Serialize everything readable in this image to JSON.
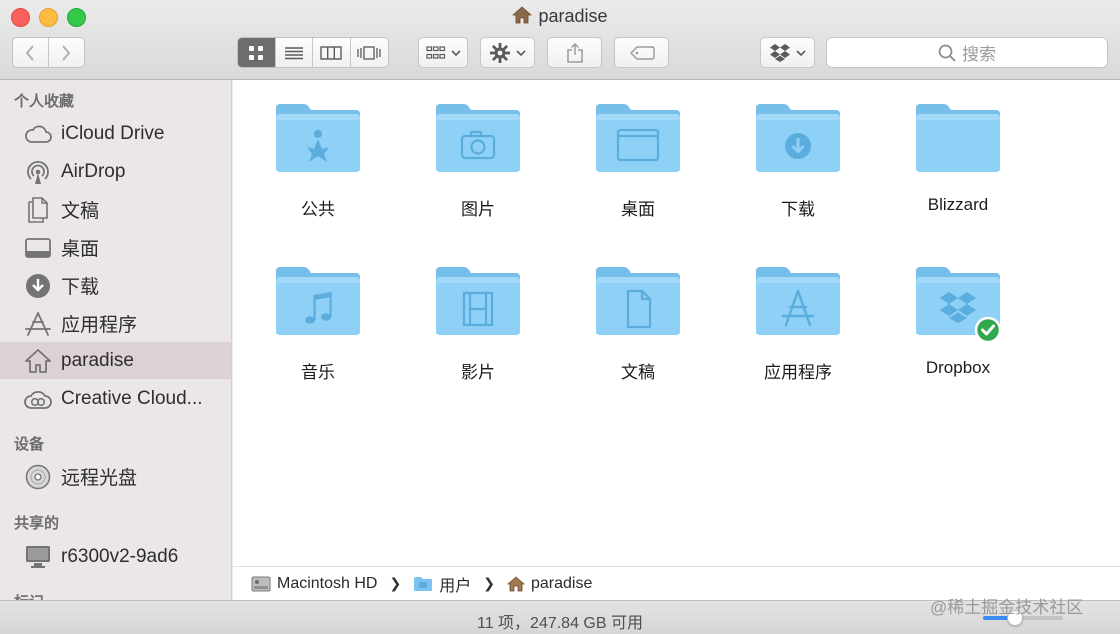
{
  "window": {
    "title": "paradise"
  },
  "toolbar": {
    "view_modes": [
      "icon",
      "list",
      "column",
      "coverflow"
    ],
    "active_view": 0,
    "search_placeholder": "搜索"
  },
  "sidebar": {
    "groups": [
      {
        "title": "个人收藏",
        "items": [
          {
            "label": "iCloud Drive",
            "icon": "cloud-icon"
          },
          {
            "label": "AirDrop",
            "icon": "airdrop-icon"
          },
          {
            "label": "文稿",
            "icon": "documents-icon"
          },
          {
            "label": "桌面",
            "icon": "desktop-icon"
          },
          {
            "label": "下载",
            "icon": "download-icon"
          },
          {
            "label": "应用程序",
            "icon": "applications-icon"
          },
          {
            "label": "paradise",
            "icon": "home-icon",
            "selected": true
          },
          {
            "label": "Creative Cloud...",
            "icon": "creative-cloud-icon"
          }
        ]
      },
      {
        "title": "设备",
        "items": [
          {
            "label": "远程光盘",
            "icon": "disc-icon"
          }
        ]
      },
      {
        "title": "共享的",
        "items": [
          {
            "label": "r6300v2-9ad6",
            "icon": "monitor-icon"
          }
        ]
      },
      {
        "title": "标记",
        "items": []
      }
    ]
  },
  "files": [
    {
      "name": "公共",
      "glyph": "public"
    },
    {
      "name": "图片",
      "glyph": "camera"
    },
    {
      "name": "桌面",
      "glyph": "window"
    },
    {
      "name": "下载",
      "glyph": "download"
    },
    {
      "name": "Blizzard",
      "glyph": "none"
    },
    {
      "name": "音乐",
      "glyph": "music"
    },
    {
      "name": "影片",
      "glyph": "film"
    },
    {
      "name": "文稿",
      "glyph": "document"
    },
    {
      "name": "应用程序",
      "glyph": "apps"
    },
    {
      "name": "Dropbox",
      "glyph": "dropbox",
      "synced": true
    }
  ],
  "pathbar": {
    "crumbs": [
      {
        "label": "Macintosh HD",
        "icon": "hard-drive-icon"
      },
      {
        "label": "用户",
        "icon": "folder-icon"
      },
      {
        "label": "paradise",
        "icon": "home-icon"
      }
    ]
  },
  "status": {
    "text": "11 项，247.84 GB 可用",
    "icon_size_fraction": 0.38
  },
  "watermark": "@稀土掘金技术社区",
  "colors": {
    "folder_front": "#8ed0f6",
    "folder_back": "#76bfea",
    "glyph": "#5aaddd",
    "selection": "#dcd2d3",
    "badge": "#2fa84f"
  }
}
